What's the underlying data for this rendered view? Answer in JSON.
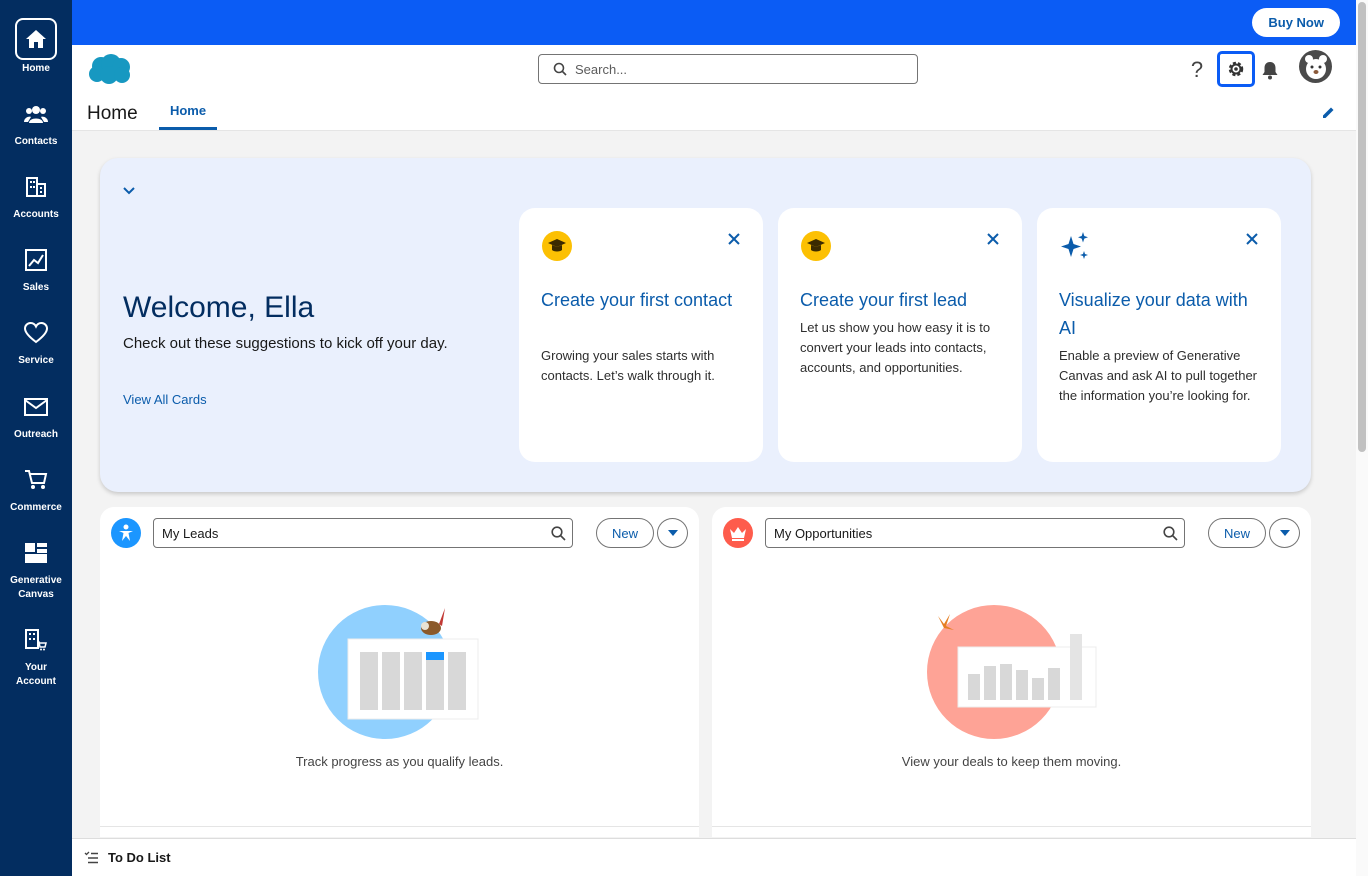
{
  "topbar": {
    "buy_now_label": "Buy Now",
    "bg_color": "#0b5cf5"
  },
  "leftnav": {
    "bg_color": "#032d60",
    "items": [
      {
        "label": "Home",
        "icon": "home-icon"
      },
      {
        "label": "Contacts",
        "icon": "contacts-icon"
      },
      {
        "label": "Accounts",
        "icon": "building-icon"
      },
      {
        "label": "Sales",
        "icon": "chart-icon"
      },
      {
        "label": "Service",
        "icon": "heart-icon"
      },
      {
        "label": "Outreach",
        "icon": "envelope-icon"
      },
      {
        "label": "Commerce",
        "icon": "cart-icon"
      },
      {
        "label": "Generative Canvas",
        "icon": "dashboard-icon"
      },
      {
        "label": "Your Account",
        "icon": "building-cart-icon"
      }
    ]
  },
  "header": {
    "search_placeholder": "Search...",
    "page_title": "Home",
    "active_tab": "Home",
    "help_label": "?"
  },
  "welcome": {
    "title": "Welcome, Ella",
    "subtitle": "Check out these suggestions to kick off your day.",
    "view_all_label": "View All Cards",
    "cards": [
      {
        "title": "Create your first contact",
        "body": "Growing your sales starts with contacts. Let’s walk through it.",
        "icon": "graduation-cap-icon"
      },
      {
        "title": "Create your first lead",
        "body": "Let us show you how easy it is to convert your leads into contacts, accounts, and opportunities.",
        "icon": "graduation-cap-icon"
      },
      {
        "title": "Visualize your data with AI",
        "body": "Enable a preview of Generative Canvas and ask AI to pull together the information you’re looking for.",
        "icon": "sparkle-icon"
      }
    ]
  },
  "panels": {
    "leads": {
      "list_name": "My Leads",
      "new_label": "New",
      "caption": "Track progress as you qualify leads.",
      "badge_color": "#1b96ff"
    },
    "opportunities": {
      "list_name": "My Opportunities",
      "new_label": "New",
      "caption": "View your deals to keep them moving.",
      "badge_color": "#fe5c4c"
    }
  },
  "footer": {
    "todo_label": "To Do List"
  }
}
